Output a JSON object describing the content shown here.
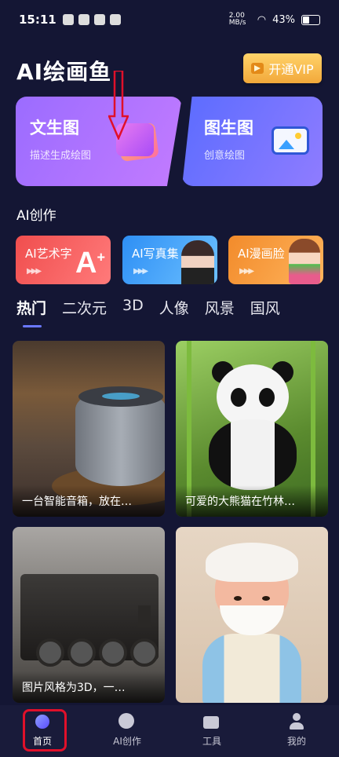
{
  "status": {
    "time": "15:11",
    "speed": "2.00 MB/s",
    "battery": "43%"
  },
  "header": {
    "title": "AI绘画鱼",
    "vip_label": "开通VIP"
  },
  "feature_cards": [
    {
      "title": "文生图",
      "subtitle": "描述生成绘图"
    },
    {
      "title": "图生图",
      "subtitle": "创意绘图"
    }
  ],
  "section": {
    "title": "AI创作"
  },
  "creation_items": [
    {
      "label": "AI艺术字"
    },
    {
      "label": "AI写真集"
    },
    {
      "label": "AI漫画脸"
    }
  ],
  "tabs": [
    {
      "label": "热门",
      "active": true
    },
    {
      "label": "二次元"
    },
    {
      "label": "3D"
    },
    {
      "label": "人像"
    },
    {
      "label": "风景"
    },
    {
      "label": "国风"
    }
  ],
  "gallery": [
    {
      "caption": "一台智能音箱，放在…"
    },
    {
      "caption": "可爱的大熊猫在竹林…"
    },
    {
      "caption": "图片风格为3D，一…"
    },
    {
      "caption": ""
    }
  ],
  "bottom_nav": [
    {
      "label": "首页",
      "icon": "planet-icon",
      "active": true
    },
    {
      "label": "AI创作",
      "icon": "palette-icon"
    },
    {
      "label": "工具",
      "icon": "toolbox-icon"
    },
    {
      "label": "我的",
      "icon": "person-icon"
    }
  ],
  "colors": {
    "background": "#141634",
    "highlight": "#e0102a",
    "vip": "#f2a83a",
    "arrow": "#e0102a"
  }
}
